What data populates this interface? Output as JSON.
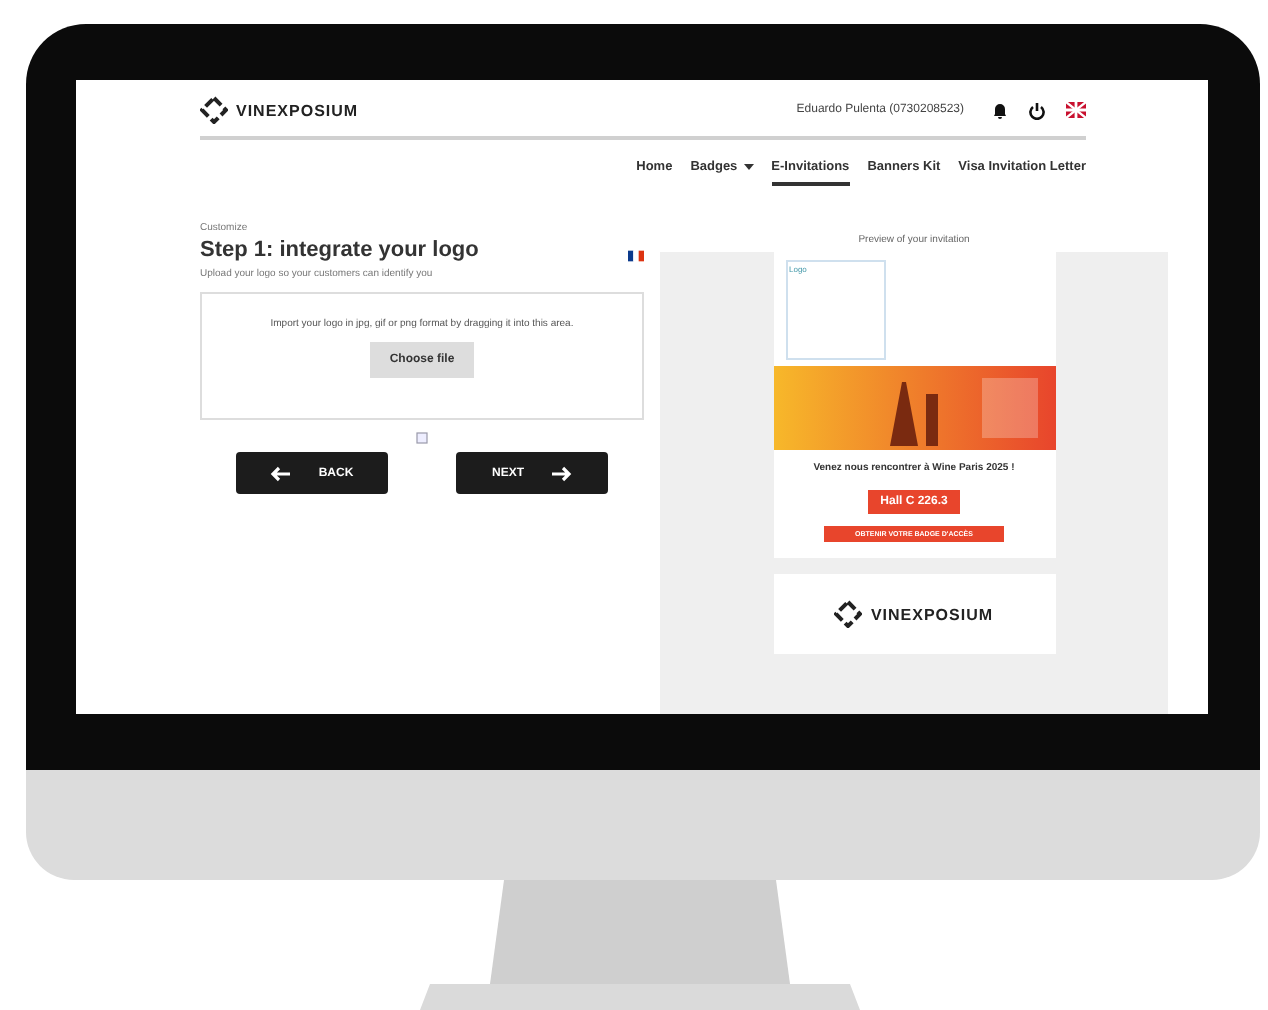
{
  "header": {
    "logo": "VINEXPOSIUM",
    "user": "Eduardo Pulenta (0730208523)"
  },
  "nav": [
    {
      "label": "Home",
      "selected": false,
      "dropdown": false
    },
    {
      "label": "Badges",
      "selected": false,
      "dropdown": true
    },
    {
      "label": "E-Invitations",
      "selected": true,
      "dropdown": false
    },
    {
      "label": "Banners Kit",
      "selected": false,
      "dropdown": false
    },
    {
      "label": "Visa Invitation Letter",
      "selected": false,
      "dropdown": false
    }
  ],
  "editor": {
    "breadcrumb": "Customize",
    "title": "Step 1: integrate your logo",
    "subtitle": "Upload your logo so your customers can identify you",
    "dropzone": {
      "hint": "Import your logo in jpg, gif or png format by dragging it into this area.",
      "button": "Choose file"
    },
    "back": "BACK",
    "next": "NEXT"
  },
  "preview": {
    "title": "Preview of your invitation",
    "logo_label": "Logo",
    "headline": "Venez nous rencontrer à Wine Paris 2025 !",
    "stand": "Hall C 226.3",
    "cta": "OBTENIR VOTRE BADGE D'ACCÈS",
    "footer_logo": "VINEXPOSIUM"
  }
}
